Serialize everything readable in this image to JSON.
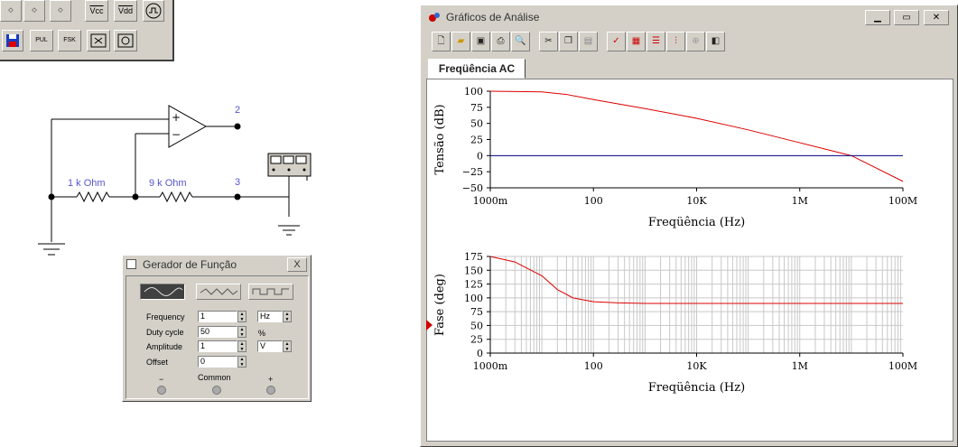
{
  "components": {
    "vcc_label": "Vcc",
    "vdd_label": "Vdd",
    "pul_label": "PUL",
    "fsk_label": "FSK"
  },
  "schematic": {
    "r1_label": "1 k Ohm",
    "r2_label": "9 k Ohm",
    "node2_label": "2",
    "node3_label": "3",
    "opamp_plus": "+",
    "opamp_minus": "−"
  },
  "function_generator": {
    "title": "Gerador de Função",
    "close_label": "X",
    "frequency_label": "Frequency",
    "frequency_value": "1",
    "frequency_unit": "Hz",
    "duty_cycle_label": "Duty cycle",
    "duty_cycle_value": "50",
    "duty_cycle_unit": "%",
    "amplitude_label": "Amplitude",
    "amplitude_value": "1",
    "amplitude_unit": "V",
    "offset_label": "Offset",
    "offset_value": "0",
    "minus_label": "−",
    "common_label": "Common",
    "plus_label": "+"
  },
  "analysis_window": {
    "title": "Gráficos de Análise",
    "tab_label": "Freqüência AC",
    "toolbar_icons": [
      "new-icon",
      "open-icon",
      "save-icon",
      "print-icon",
      "print-preview-icon",
      "cut-icon",
      "copy-icon",
      "paste-icon",
      "properties-icon",
      "grid-icon",
      "legend-icon",
      "cursor-icon",
      "zoom-icon",
      "overlay-icon"
    ]
  },
  "chart_data": [
    {
      "type": "line",
      "xlabel": "Freqüência (Hz)",
      "ylabel": "Tensão (dB)",
      "xscale": "log",
      "xlim": [
        1,
        100000000
      ],
      "ylim": [
        -50,
        100
      ],
      "xtick_labels": [
        "1000m",
        "100",
        "10K",
        "1M",
        "100M"
      ],
      "ytick_labels": [
        "100",
        "75",
        "50",
        "25",
        "0",
        "−25",
        "−50"
      ],
      "grid": false,
      "series": [
        {
          "color": "#dd0000",
          "x": [
            1,
            10,
            30,
            100,
            1000,
            10000,
            100000,
            1000000,
            10000000,
            100000000
          ],
          "y": [
            100,
            99,
            95,
            87,
            73,
            58,
            40,
            20,
            0,
            -40
          ]
        },
        {
          "color": "#000080",
          "x": [
            1,
            100000000
          ],
          "y": [
            0,
            0
          ]
        }
      ]
    },
    {
      "type": "line",
      "xlabel": "Freqüência (Hz)",
      "ylabel": "Fase (deg)",
      "xscale": "log",
      "xlim": [
        1,
        100000000
      ],
      "ylim": [
        0,
        175
      ],
      "xtick_labels": [
        "1000m",
        "100",
        "10K",
        "1M",
        "100M"
      ],
      "ytick_labels": [
        "175",
        "150",
        "125",
        "100",
        "75",
        "50",
        "25",
        "0"
      ],
      "grid": true,
      "series": [
        {
          "color": "#dd0000",
          "x": [
            1,
            3,
            10,
            20,
            40,
            100,
            300,
            1000,
            100000000
          ],
          "y": [
            175,
            165,
            140,
            115,
            100,
            93,
            91,
            90,
            90
          ]
        }
      ]
    }
  ]
}
